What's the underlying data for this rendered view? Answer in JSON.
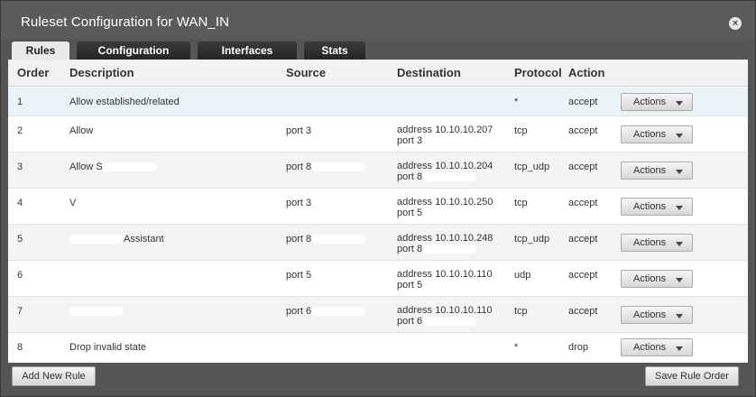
{
  "dialog": {
    "title": "Ruleset Configuration for WAN_IN",
    "close_glyph": "×"
  },
  "tabs": [
    {
      "label": "Rules"
    },
    {
      "label": "Configuration"
    },
    {
      "label": "Interfaces"
    },
    {
      "label": "Stats"
    }
  ],
  "table": {
    "headers": {
      "order": "Order",
      "description": "Description",
      "source": "Source",
      "destination": "Destination",
      "protocol": "Protocol",
      "action": "Action"
    },
    "rows": [
      {
        "order": "1",
        "description": "Allow established/related",
        "source": "",
        "dest1": "",
        "dest2": "",
        "protocol": "*",
        "action": "accept",
        "button": "Actions"
      },
      {
        "order": "2",
        "description": "Allow",
        "source": "port 3",
        "dest1": "address 10.10.10.207",
        "dest2": "port 3",
        "protocol": "tcp",
        "action": "accept",
        "button": "Actions"
      },
      {
        "order": "3",
        "description": "Allow S",
        "source": "port 8",
        "dest1": "address 10.10.10.204",
        "dest2": "port 8",
        "protocol": "tcp_udp",
        "action": "accept",
        "button": "Actions"
      },
      {
        "order": "4",
        "description": "V",
        "source": "port 3",
        "dest1": "address 10.10.10.250",
        "dest2": "port 5",
        "protocol": "tcp",
        "action": "accept",
        "button": "Actions"
      },
      {
        "order": "5",
        "description": "Assistant",
        "source": "port 8",
        "dest1": "address 10.10.10.248",
        "dest2": "port 8",
        "protocol": "tcp_udp",
        "action": "accept",
        "button": "Actions"
      },
      {
        "order": "6",
        "description": "",
        "source": "port 5",
        "dest1": "address 10.10.10.110",
        "dest2": "port 5",
        "protocol": "udp",
        "action": "accept",
        "button": "Actions"
      },
      {
        "order": "7",
        "description": "",
        "source": "port 6",
        "dest1": "address 10.10.10.110",
        "dest2": "port 6",
        "protocol": "tcp",
        "action": "accept",
        "button": "Actions"
      },
      {
        "order": "8",
        "description": "Drop invalid state",
        "source": "",
        "dest1": "",
        "dest2": "",
        "protocol": "*",
        "action": "drop",
        "button": "Actions"
      }
    ]
  },
  "footer": {
    "add_label": "Add New Rule",
    "save_label": "Save Rule Order"
  },
  "colors": {
    "header_bg": "#5b5b5b",
    "active_tab": "#e9e9e9",
    "selected_row": "#e9f3f8"
  },
  "icons": {
    "close": "close-icon",
    "dropdown": "chevron-down-icon"
  }
}
